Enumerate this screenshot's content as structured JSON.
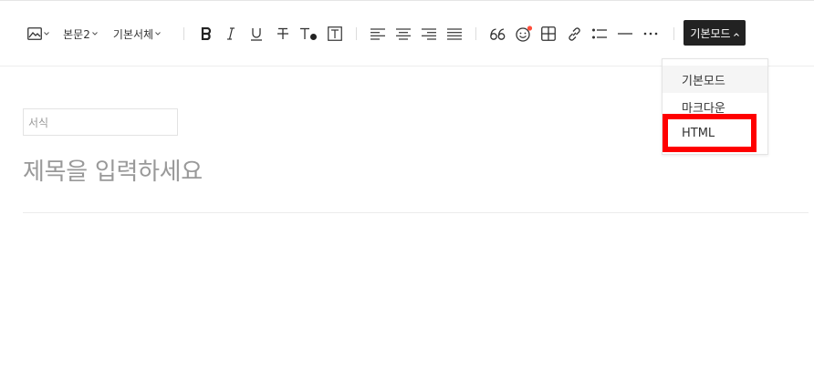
{
  "toolbar": {
    "image_icon": "image-icon",
    "paragraph_style": "본문2",
    "font_family": "기본서체",
    "icons": [
      "bold-icon",
      "italic-icon",
      "underline-icon",
      "strikethrough-icon",
      "text-color-icon",
      "text-background-icon",
      "align-left-icon",
      "align-center-icon",
      "align-right-icon",
      "align-justify-icon",
      "quote-icon",
      "emoticon-icon",
      "table-icon",
      "link-icon",
      "bullet-list-icon",
      "horizontal-rule-icon",
      "more-icon"
    ],
    "mode_button": "기본모드",
    "emoticon_dot_color": "#ff4d3a"
  },
  "mode_menu": {
    "items": [
      {
        "label": "기본모드",
        "active": true
      },
      {
        "label": "마크다운",
        "active": false
      },
      {
        "label": "HTML",
        "active": false,
        "highlighted": true
      }
    ],
    "highlight_color": "#ff0000"
  },
  "editor": {
    "format_placeholder": "서식",
    "title_placeholder": "제목을 입력하세요"
  }
}
